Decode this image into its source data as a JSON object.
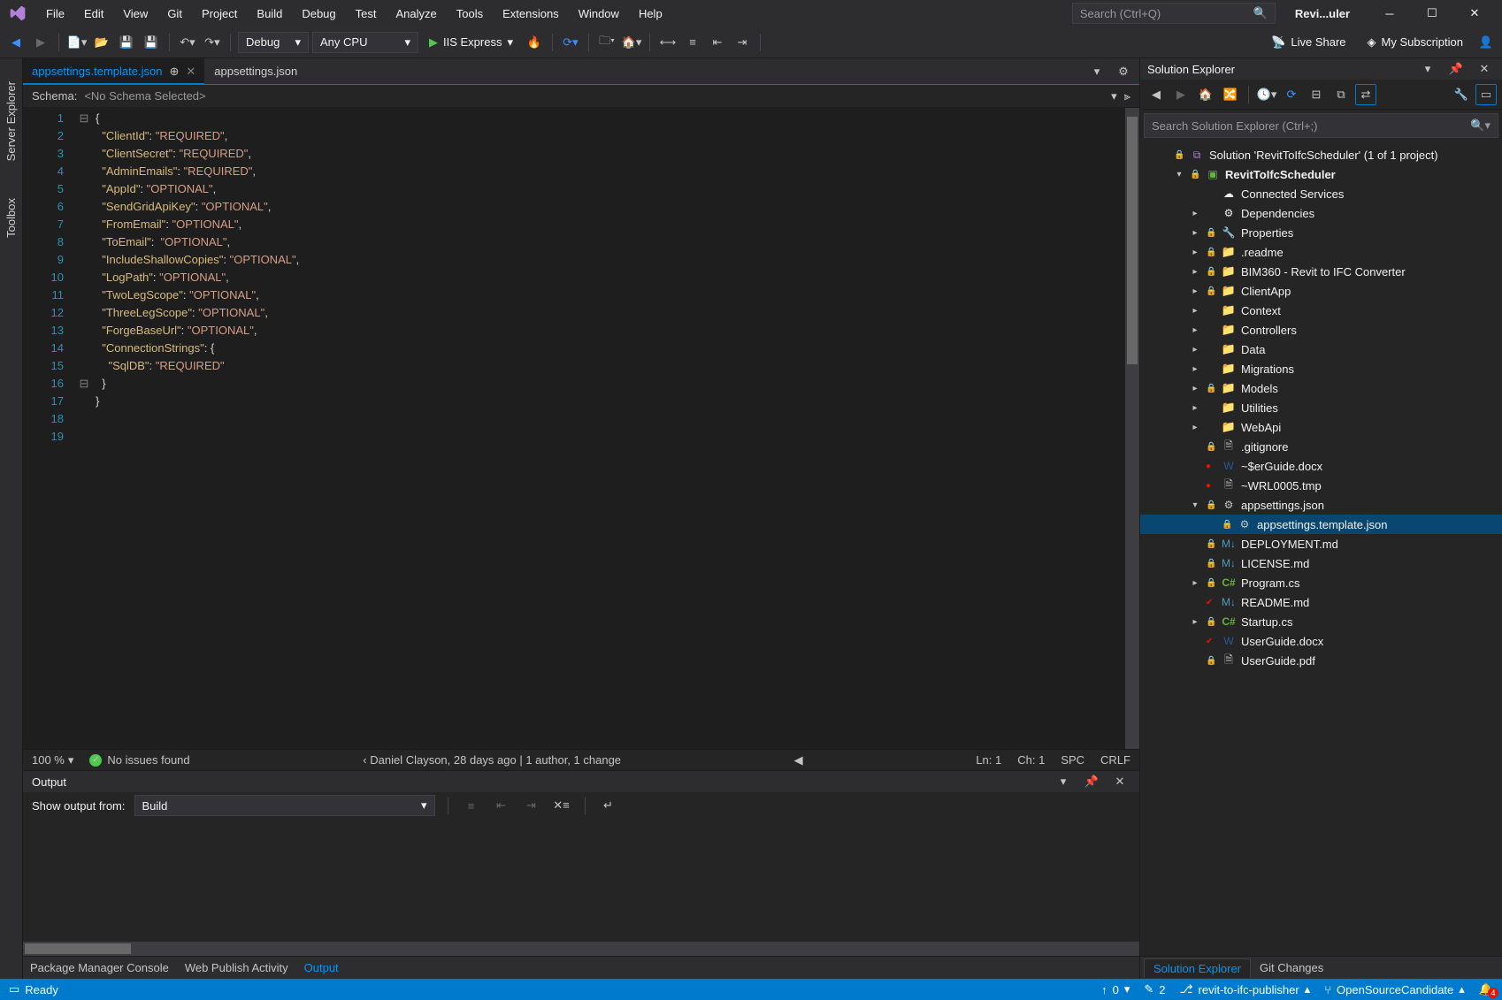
{
  "title_bar": {
    "app_name": "Revi...uler",
    "search_placeholder": "Search (Ctrl+Q)"
  },
  "menu": [
    "File",
    "Edit",
    "View",
    "Git",
    "Project",
    "Build",
    "Debug",
    "Test",
    "Analyze",
    "Tools",
    "Extensions",
    "Window",
    "Help"
  ],
  "toolbar": {
    "config": "Debug",
    "platform": "Any CPU",
    "run_target": "IIS Express",
    "live_share": "Live Share",
    "subscription": "My Subscription"
  },
  "left_rails": [
    "Server Explorer",
    "Toolbox"
  ],
  "tabs": {
    "active": "appsettings.template.json",
    "inactive": "appsettings.json"
  },
  "schema": {
    "label": "Schema:",
    "value": "<No Schema Selected>"
  },
  "code_lines": [
    {
      "n": 1,
      "fold": "⊟",
      "html": "<span class='br'>{</span>"
    },
    {
      "n": 2,
      "fold": "",
      "html": "  <span class='key'>\"ClientId\"</span><span class='pn'>: </span><span class='str'>\"REQUIRED\"</span><span class='pn'>,</span>"
    },
    {
      "n": 3,
      "fold": "",
      "html": "  <span class='key'>\"ClientSecret\"</span><span class='pn'>: </span><span class='str'>\"REQUIRED\"</span><span class='pn'>,</span>"
    },
    {
      "n": 4,
      "fold": "",
      "html": "  <span class='key'>\"AdminEmails\"</span><span class='pn'>: </span><span class='str'>\"REQUIRED\"</span><span class='pn'>,</span>"
    },
    {
      "n": 5,
      "fold": "",
      "html": ""
    },
    {
      "n": 6,
      "fold": "",
      "html": "  <span class='key'>\"AppId\"</span><span class='pn'>: </span><span class='str'>\"OPTIONAL\"</span><span class='pn'>,</span>"
    },
    {
      "n": 7,
      "fold": "",
      "html": "  <span class='key'>\"SendGridApiKey\"</span><span class='pn'>: </span><span class='str'>\"OPTIONAL\"</span><span class='pn'>,</span>"
    },
    {
      "n": 8,
      "fold": "",
      "html": "  <span class='key'>\"FromEmail\"</span><span class='pn'>: </span><span class='str'>\"OPTIONAL\"</span><span class='pn'>,</span>"
    },
    {
      "n": 9,
      "fold": "",
      "html": "  <span class='key'>\"ToEmail\"</span><span class='pn'>:  </span><span class='str'>\"OPTIONAL\"</span><span class='pn'>,</span>"
    },
    {
      "n": 10,
      "fold": "",
      "html": "  <span class='key'>\"IncludeShallowCopies\"</span><span class='pn'>: </span><span class='str'>\"OPTIONAL\"</span><span class='pn'>,</span>"
    },
    {
      "n": 11,
      "fold": "",
      "html": "  <span class='key'>\"LogPath\"</span><span class='pn'>: </span><span class='str'>\"OPTIONAL\"</span><span class='pn'>,</span>"
    },
    {
      "n": 12,
      "fold": "",
      "html": "  <span class='key'>\"TwoLegScope\"</span><span class='pn'>: </span><span class='str'>\"OPTIONAL\"</span><span class='pn'>,</span>"
    },
    {
      "n": 13,
      "fold": "",
      "html": "  <span class='key'>\"ThreeLegScope\"</span><span class='pn'>: </span><span class='str'>\"OPTIONAL\"</span><span class='pn'>,</span>"
    },
    {
      "n": 14,
      "fold": "",
      "html": "  <span class='key'>\"ForgeBaseUrl\"</span><span class='pn'>: </span><span class='str'>\"OPTIONAL\"</span><span class='pn'>,</span>"
    },
    {
      "n": 15,
      "fold": "",
      "html": ""
    },
    {
      "n": 16,
      "fold": "⊟",
      "html": "  <span class='key'>\"ConnectionStrings\"</span><span class='pn'>: </span><span class='br'>{</span>"
    },
    {
      "n": 17,
      "fold": "",
      "html": "    <span class='key'>\"SqlDB\"</span><span class='pn'>: </span><span class='str'>\"REQUIRED\"</span>"
    },
    {
      "n": 18,
      "fold": "",
      "html": "  <span class='br'>}</span>"
    },
    {
      "n": 19,
      "fold": "",
      "html": "<span class='br'>}</span>"
    }
  ],
  "editor_status": {
    "zoom": "100 %",
    "issues": "No issues found",
    "codelens": "Daniel Clayson, 28 days ago | 1 author, 1 change",
    "ln": "Ln: 1",
    "ch": "Ch: 1",
    "spc": "SPC",
    "crlf": "CRLF"
  },
  "output": {
    "title": "Output",
    "show_label": "Show output from:",
    "source": "Build"
  },
  "bottom_tabs": {
    "items": [
      "Package Manager Console",
      "Web Publish Activity",
      "Output"
    ],
    "active": "Output"
  },
  "solution_explorer": {
    "title": "Solution Explorer",
    "search_placeholder": "Search Solution Explorer (Ctrl+;)",
    "nodes": [
      {
        "d": 0,
        "exp": "",
        "ico": "sln",
        "pre": "🔒",
        "label": "Solution 'RevitToIfcScheduler' (1 of 1 project)"
      },
      {
        "d": 1,
        "exp": "▾",
        "ico": "csproj",
        "pre": "🔒",
        "label": "RevitToIfcScheduler",
        "bold": true
      },
      {
        "d": 2,
        "exp": "",
        "ico": "conn",
        "pre": "",
        "label": "Connected Services"
      },
      {
        "d": 2,
        "exp": "▸",
        "ico": "dep",
        "pre": "",
        "label": "Dependencies"
      },
      {
        "d": 2,
        "exp": "▸",
        "ico": "prop",
        "pre": "🔒",
        "label": "Properties"
      },
      {
        "d": 2,
        "exp": "▸",
        "ico": "folder",
        "pre": "🔒",
        "label": ".readme"
      },
      {
        "d": 2,
        "exp": "▸",
        "ico": "folder",
        "pre": "🔒",
        "label": "BIM360 - Revit to IFC Converter"
      },
      {
        "d": 2,
        "exp": "▸",
        "ico": "folder",
        "pre": "🔒",
        "label": "ClientApp"
      },
      {
        "d": 2,
        "exp": "▸",
        "ico": "folder",
        "pre": "",
        "label": "Context"
      },
      {
        "d": 2,
        "exp": "▸",
        "ico": "folder",
        "pre": "",
        "label": "Controllers"
      },
      {
        "d": 2,
        "exp": "▸",
        "ico": "folder",
        "pre": "",
        "label": "Data"
      },
      {
        "d": 2,
        "exp": "▸",
        "ico": "folder",
        "pre": "",
        "label": "Migrations"
      },
      {
        "d": 2,
        "exp": "▸",
        "ico": "folder",
        "pre": "🔒",
        "label": "Models"
      },
      {
        "d": 2,
        "exp": "▸",
        "ico": "folder",
        "pre": "",
        "label": "Utilities"
      },
      {
        "d": 2,
        "exp": "▸",
        "ico": "folder",
        "pre": "",
        "label": "WebApi"
      },
      {
        "d": 2,
        "exp": "",
        "ico": "txt",
        "pre": "🔒",
        "label": ".gitignore"
      },
      {
        "d": 2,
        "exp": "",
        "ico": "doc",
        "pre": "●",
        "label": "~$erGuide.docx"
      },
      {
        "d": 2,
        "exp": "",
        "ico": "txt",
        "pre": "●",
        "label": "~WRL0005.tmp"
      },
      {
        "d": 2,
        "exp": "▾",
        "ico": "json",
        "pre": "🔒",
        "label": "appsettings.json"
      },
      {
        "d": 3,
        "exp": "",
        "ico": "json",
        "pre": "🔒",
        "label": "appsettings.template.json",
        "sel": true
      },
      {
        "d": 2,
        "exp": "",
        "ico": "md",
        "pre": "🔒",
        "label": "DEPLOYMENT.md"
      },
      {
        "d": 2,
        "exp": "",
        "ico": "md",
        "pre": "🔒",
        "label": "LICENSE.md"
      },
      {
        "d": 2,
        "exp": "▸",
        "ico": "cs",
        "pre": "🔒",
        "label": "Program.cs"
      },
      {
        "d": 2,
        "exp": "",
        "ico": "md",
        "pre": "✔",
        "label": "README.md"
      },
      {
        "d": 2,
        "exp": "▸",
        "ico": "cs",
        "pre": "🔒",
        "label": "Startup.cs"
      },
      {
        "d": 2,
        "exp": "",
        "ico": "doc",
        "pre": "✔",
        "label": "UserGuide.docx"
      },
      {
        "d": 2,
        "exp": "",
        "ico": "txt",
        "pre": "🔒",
        "label": "UserGuide.pdf"
      }
    ],
    "bottom_tabs": {
      "items": [
        "Solution Explorer",
        "Git Changes"
      ],
      "active": "Solution Explorer"
    }
  },
  "status_bar": {
    "ready": "Ready",
    "up": "0",
    "pencil": "2",
    "repo": "revit-to-ifc-publisher",
    "branch": "OpenSourceCandidate",
    "notifications": "4"
  }
}
